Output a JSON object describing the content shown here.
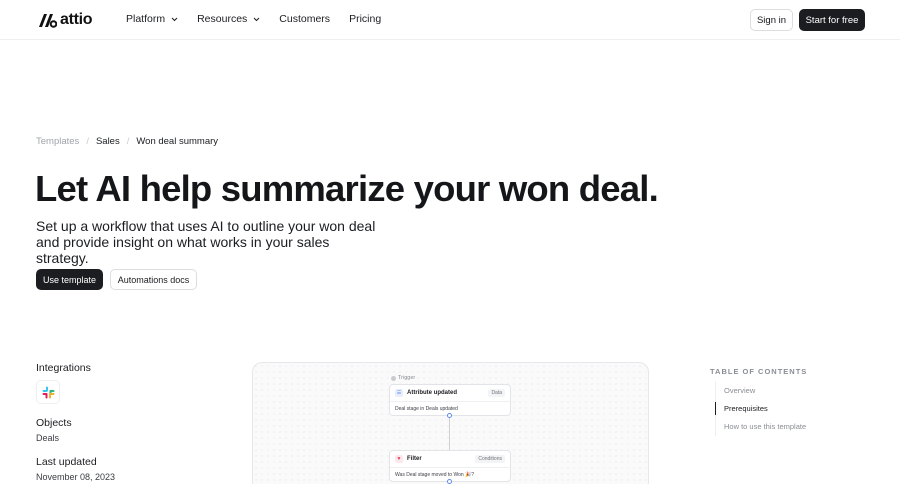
{
  "header": {
    "logo_text": "attio",
    "nav": [
      {
        "label": "Platform"
      },
      {
        "label": "Resources"
      },
      {
        "label": "Customers"
      },
      {
        "label": "Pricing"
      }
    ],
    "sign_in_label": "Sign in",
    "start_label": "Start for free"
  },
  "breadcrumb": [
    "Templates",
    "Sales",
    "Won deal summary"
  ],
  "hero": {
    "title": "Let AI help summarize your won deal.",
    "subtitle": "Set up a workflow that uses AI to outline your won deal and provide insight on what works in your sales strategy.",
    "use_template_label": "Use template",
    "docs_label": "Automations docs"
  },
  "meta": {
    "integrations_label": "Integrations",
    "integration_icon": "slack-icon",
    "objects_label": "Objects",
    "objects_value": "Deals",
    "last_updated_label": "Last updated",
    "last_updated_value": "November 08, 2023"
  },
  "workflow": {
    "trigger_label": "Trigger",
    "nodes": [
      {
        "title": "Attribute updated",
        "badge": "Data",
        "body": "Deal stage in Deals updated"
      },
      {
        "title": "Filter",
        "badge": "Conditions",
        "body": "Was Deal stage moved to Won 🎉?"
      }
    ]
  },
  "toc": {
    "title": "TABLE OF CONTENTS",
    "items": [
      "Overview",
      "Prerequisites",
      "How to use this template"
    ],
    "active_index": 1
  },
  "colors": {
    "primary_dark": "#1c1d21",
    "muted_text": "#8a8d95",
    "border": "#dcdde1",
    "port_blue": "#5b8def"
  }
}
